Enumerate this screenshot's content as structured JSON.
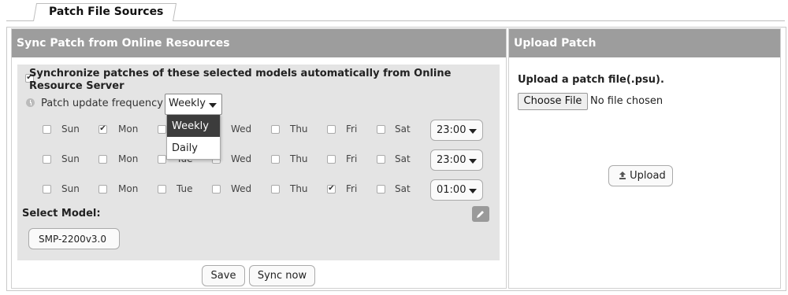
{
  "tab": {
    "label": "Patch File Sources"
  },
  "sync_panel": {
    "header": "Sync Patch from Online Resources",
    "auto_sync_label": "Synchronize patches of these selected models automatically from Online Resource Server",
    "auto_sync_checked": true,
    "frequency_label": "Patch update frequency",
    "frequency_value": "Weekly",
    "frequency_options": [
      "Weekly",
      "Daily"
    ],
    "days": [
      "Sun",
      "Mon",
      "Tue",
      "Wed",
      "Thu",
      "Fri",
      "Sat"
    ],
    "schedules": [
      {
        "checked": [
          false,
          true,
          false,
          false,
          false,
          false,
          false
        ],
        "time": "23:00"
      },
      {
        "checked": [
          false,
          false,
          false,
          false,
          false,
          false,
          false
        ],
        "time": "23:00"
      },
      {
        "checked": [
          false,
          false,
          false,
          false,
          false,
          true,
          false
        ],
        "time": "01:00"
      }
    ],
    "select_model_label": "Select Model:",
    "model": "SMP-2200v3.0",
    "save_label": "Save",
    "sync_now_label": "Sync now"
  },
  "upload_panel": {
    "header": "Upload Patch",
    "title": "Upload a patch file(.psu).",
    "choose_file_label": "Choose File",
    "no_file_text": "No file chosen",
    "upload_label": "Upload"
  },
  "colors": {
    "panel_header": "#9d9d9d",
    "inner_bg": "#e4e4e4",
    "dropdown_selected": "#3c3c3c"
  },
  "icons": {
    "clock": "clock-icon",
    "pencil": "pencil-icon",
    "upload": "upload-icon",
    "caret": "caret-down-icon"
  }
}
